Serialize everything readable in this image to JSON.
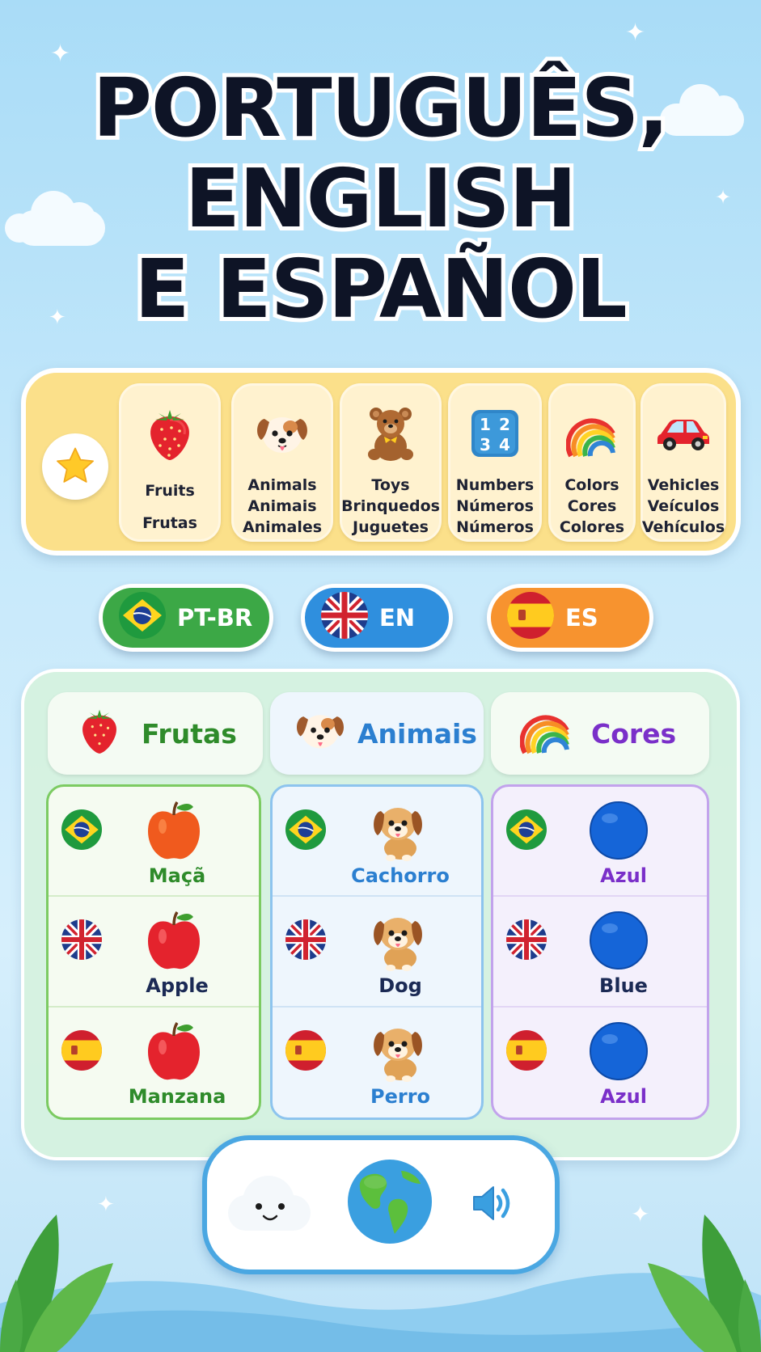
{
  "title": {
    "line1": "PORTUGUÊS,",
    "line2": "ENGLISH",
    "line3": "E ESPAÑOL"
  },
  "categories": [
    {
      "icon": "strawberry-icon",
      "lines": [
        "Fruits",
        "Frutas"
      ]
    },
    {
      "icon": "puppy-icon",
      "lines": [
        "Animals",
        "Animais",
        "Animales"
      ]
    },
    {
      "icon": "teddy-bear-icon",
      "lines": [
        "Toys",
        "Brinquedos",
        "Juguetes"
      ]
    },
    {
      "icon": "numbers-icon",
      "lines": [
        "Numbers",
        "Números",
        "Números"
      ]
    },
    {
      "icon": "rainbow-icon",
      "lines": [
        "Colors",
        "Cores",
        "Colores"
      ]
    },
    {
      "icon": "car-icon",
      "lines": [
        "Vehicles",
        "Veículos",
        "Vehículos"
      ]
    }
  ],
  "languages": [
    {
      "code": "PT-BR",
      "flag": "brazil-flag",
      "color": "#3ca846"
    },
    {
      "code": "EN",
      "flag": "uk-flag",
      "color": "#2f8fde"
    },
    {
      "code": "ES",
      "flag": "spain-flag",
      "color": "#f7932f"
    }
  ],
  "columns": [
    {
      "header": "Frutas",
      "icon": "strawberry-icon",
      "color": "#2e8b2a",
      "words": [
        {
          "flag": "brazil-flag",
          "icon": "orange-apple-icon",
          "word": "Maçã"
        },
        {
          "flag": "uk-flag",
          "icon": "red-apple-icon",
          "word": "Apple"
        },
        {
          "flag": "spain-flag",
          "icon": "red-apple-icon",
          "word": "Manzana"
        }
      ]
    },
    {
      "header": "Animais",
      "icon": "puppy-icon",
      "color": "#2b7fd0",
      "words": [
        {
          "flag": "brazil-flag",
          "icon": "dog-icon",
          "word": "Cachorro"
        },
        {
          "flag": "uk-flag",
          "icon": "dog-icon",
          "word": "Dog"
        },
        {
          "flag": "spain-flag",
          "icon": "dog-icon",
          "word": "Perro"
        }
      ]
    },
    {
      "header": "Cores",
      "icon": "rainbow-icon",
      "color": "#7a2fc9",
      "words": [
        {
          "flag": "brazil-flag",
          "icon": "blue-circle-icon",
          "word": "Azul"
        },
        {
          "flag": "uk-flag",
          "icon": "blue-circle-icon",
          "word": "Blue"
        },
        {
          "flag": "spain-flag",
          "icon": "blue-circle-icon",
          "word": "Azul"
        }
      ]
    }
  ],
  "bottom_bar": {
    "items": [
      "cloud-face-icon",
      "globe-icon",
      "speaker-icon"
    ]
  }
}
